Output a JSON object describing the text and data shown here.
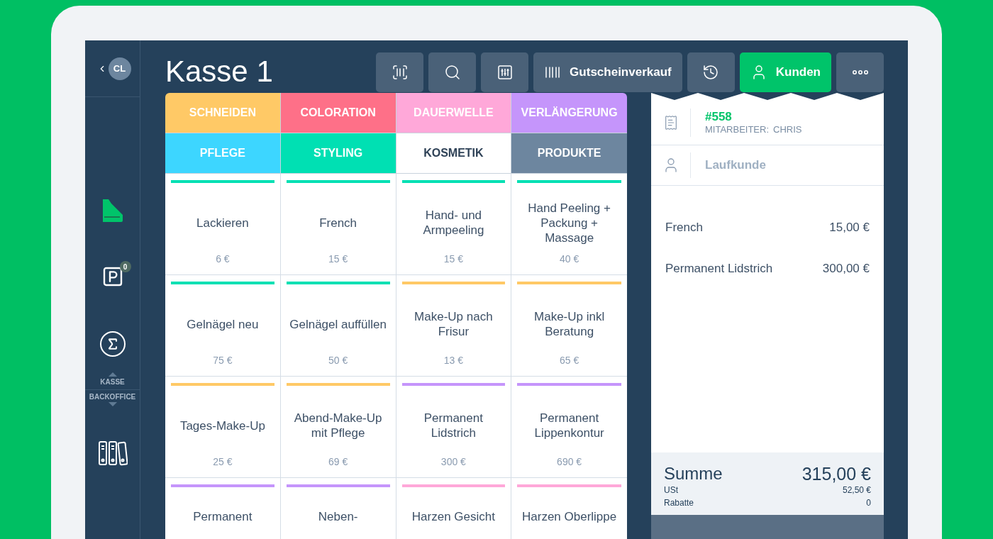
{
  "sidebar": {
    "avatar": "CL",
    "nav": [
      {
        "kind": "register",
        "selected": true
      },
      {
        "kind": "parking",
        "badge": "0",
        "selected": false
      },
      {
        "kind": "sigma",
        "selected": false
      },
      {
        "kind": "binders",
        "selected": false
      }
    ],
    "modes": [
      {
        "label": "KASSE"
      },
      {
        "label": "BACKOFFICE"
      }
    ]
  },
  "title": "Kasse 1",
  "toolbar": [
    {
      "kind": "scan",
      "highlighted": false
    },
    {
      "kind": "search",
      "highlighted": false
    },
    {
      "kind": "sliders",
      "highlighted": false
    },
    {
      "kind": "voucher",
      "label": "Gutscheinverkauf",
      "highlighted": false
    },
    {
      "kind": "history",
      "highlighted": false
    },
    {
      "kind": "customer",
      "label": "Kunden",
      "highlighted": true
    },
    {
      "kind": "more",
      "highlighted": false
    }
  ],
  "categories": [
    {
      "label": "SCHNEIDEN",
      "color": "#ffc966",
      "selected": false
    },
    {
      "label": "COLORATION",
      "color": "#fe7088",
      "selected": false
    },
    {
      "label": "DAUERWELLE",
      "color": "#ffa8d9",
      "selected": false
    },
    {
      "label": "VERLÄNGERUNG",
      "color": "#c595fb",
      "selected": false
    },
    {
      "label": "PFLEGE",
      "color": "#3dd6ff",
      "selected": false
    },
    {
      "label": "STYLING",
      "color": "#00e0b3",
      "selected": false
    },
    {
      "label": "KOSMETIK",
      "color": "#ffffff",
      "selected": true
    },
    {
      "label": "PRODUKTE",
      "color": "#6d869f",
      "selected": false
    }
  ],
  "products": [
    {
      "name": "Lackieren",
      "price": "6 €",
      "color": "#00e0b3"
    },
    {
      "name": "French",
      "price": "15 €",
      "color": "#00e0b3"
    },
    {
      "name": "Hand- und Armpeeling",
      "price": "15 €",
      "color": "#00e0b3"
    },
    {
      "name": "Hand Peeling + Packung + Massage",
      "price": "40 €",
      "color": "#00e0b3"
    },
    {
      "name": "Gelnägel neu",
      "price": "75 €",
      "color": "#00e0b3"
    },
    {
      "name": "Gelnägel auffüllen",
      "price": "50 €",
      "color": "#00e0b3"
    },
    {
      "name": "Make-Up nach Frisur",
      "price": "13 €",
      "color": "#ffc966"
    },
    {
      "name": "Make-Up inkl Beratung",
      "price": "65 €",
      "color": "#ffc966"
    },
    {
      "name": "Tages-Make-Up",
      "price": "25 €",
      "color": "#ffc966"
    },
    {
      "name": "Abend-Make-Up mit Pflege",
      "price": "69 €",
      "color": "#ffc966"
    },
    {
      "name": "Permanent Lidstrich",
      "price": "300 €",
      "color": "#c595fb"
    },
    {
      "name": "Permanent Lippenkontur",
      "price": "690 €",
      "color": "#c595fb"
    },
    {
      "name": "Permanent",
      "color": "#c595fb"
    },
    {
      "name": "Neben-",
      "color": "#c595fb"
    },
    {
      "name": "Harzen Gesicht",
      "color": "#ffa8d9"
    },
    {
      "name": "Harzen Oberlippe",
      "color": "#ffa8d9"
    }
  ],
  "receipt": {
    "number": "#558",
    "staff_label": "MITARBEITER:",
    "staff": "CHRIS",
    "customer": "Laufkunde",
    "items": [
      {
        "name": "French",
        "amount": "15,00 €"
      },
      {
        "name": "Permanent Lidstrich",
        "amount": "300,00 €"
      }
    ],
    "total_label": "Summe",
    "total": "315,00 €",
    "details": [
      {
        "label": "USt",
        "value": "52,50 €"
      },
      {
        "label": "Rabatte",
        "value": "0"
      }
    ]
  }
}
